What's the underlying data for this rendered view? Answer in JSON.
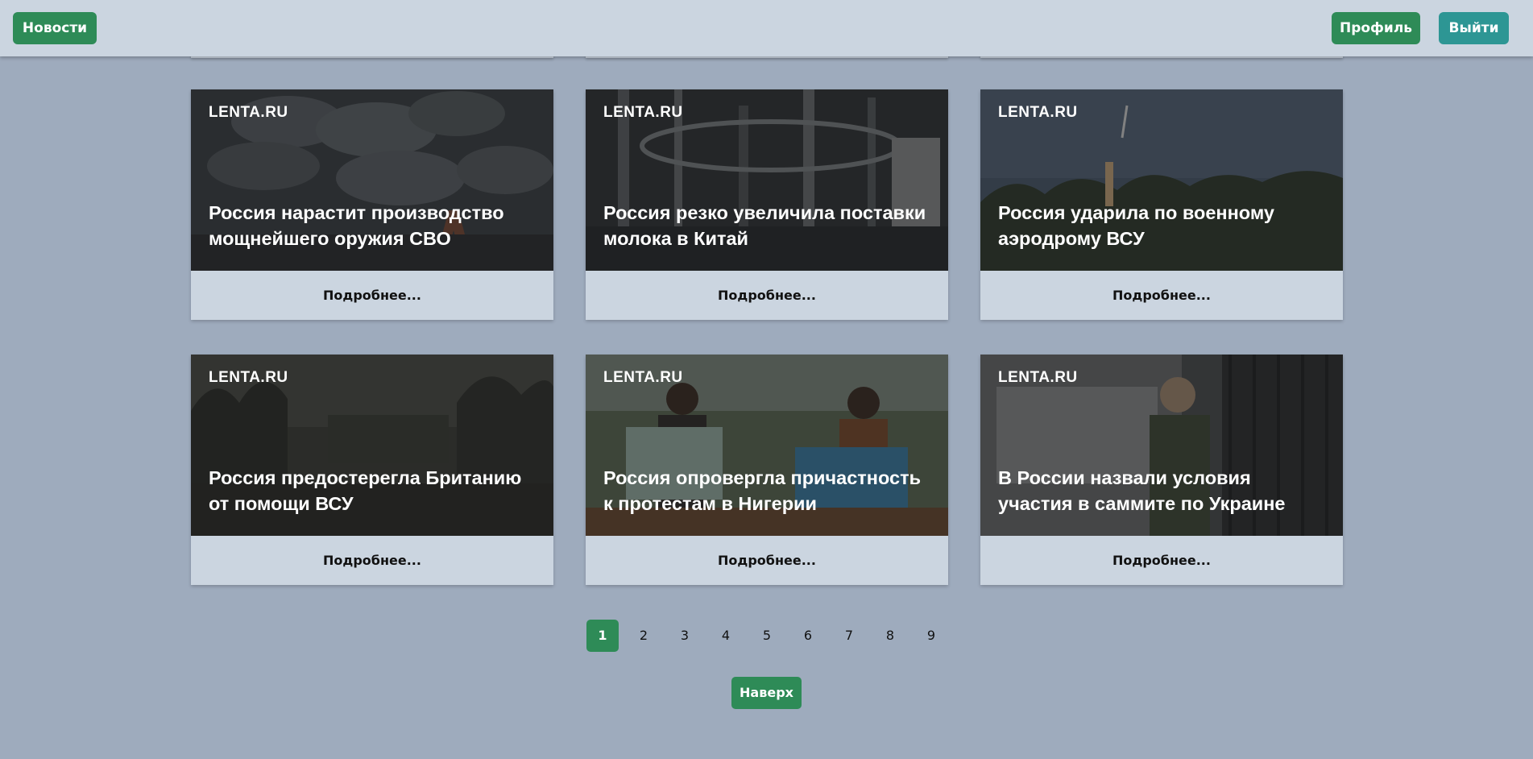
{
  "header": {
    "news_label": "Новости",
    "profile_label": "Профиль",
    "logout_label": "Выйти"
  },
  "cards": [
    {
      "source": "LENTA.RU",
      "title": "Россия нарастит производство мощнейшего оружия СВО",
      "more_label": "Подробнее..."
    },
    {
      "source": "LENTA.RU",
      "title": "Россия резко увеличила поставки молока в Китай",
      "more_label": "Подробнее..."
    },
    {
      "source": "LENTA.RU",
      "title": "Россия ударила по военному аэродрому ВСУ",
      "more_label": "Подробнее..."
    },
    {
      "source": "LENTA.RU",
      "title": "Россия предостерегла Британию от помощи ВСУ",
      "more_label": "Подробнее..."
    },
    {
      "source": "LENTA.RU",
      "title": "Россия опровергла причастность к протестам в Нигерии",
      "more_label": "Подробнее..."
    },
    {
      "source": "LENTA.RU",
      "title": "В России назвали условия участия в саммите по Украине",
      "more_label": "Подробнее..."
    }
  ],
  "pagination": {
    "current": "1",
    "pages": [
      "1",
      "2",
      "3",
      "4",
      "5",
      "6",
      "7",
      "8",
      "9"
    ]
  },
  "back_to_top_label": "Наверх",
  "colors": {
    "accent": "#2e8b57",
    "logout": "#2d9694",
    "page_bg": "#9eabbd",
    "panel_bg": "#cbd5e0"
  }
}
